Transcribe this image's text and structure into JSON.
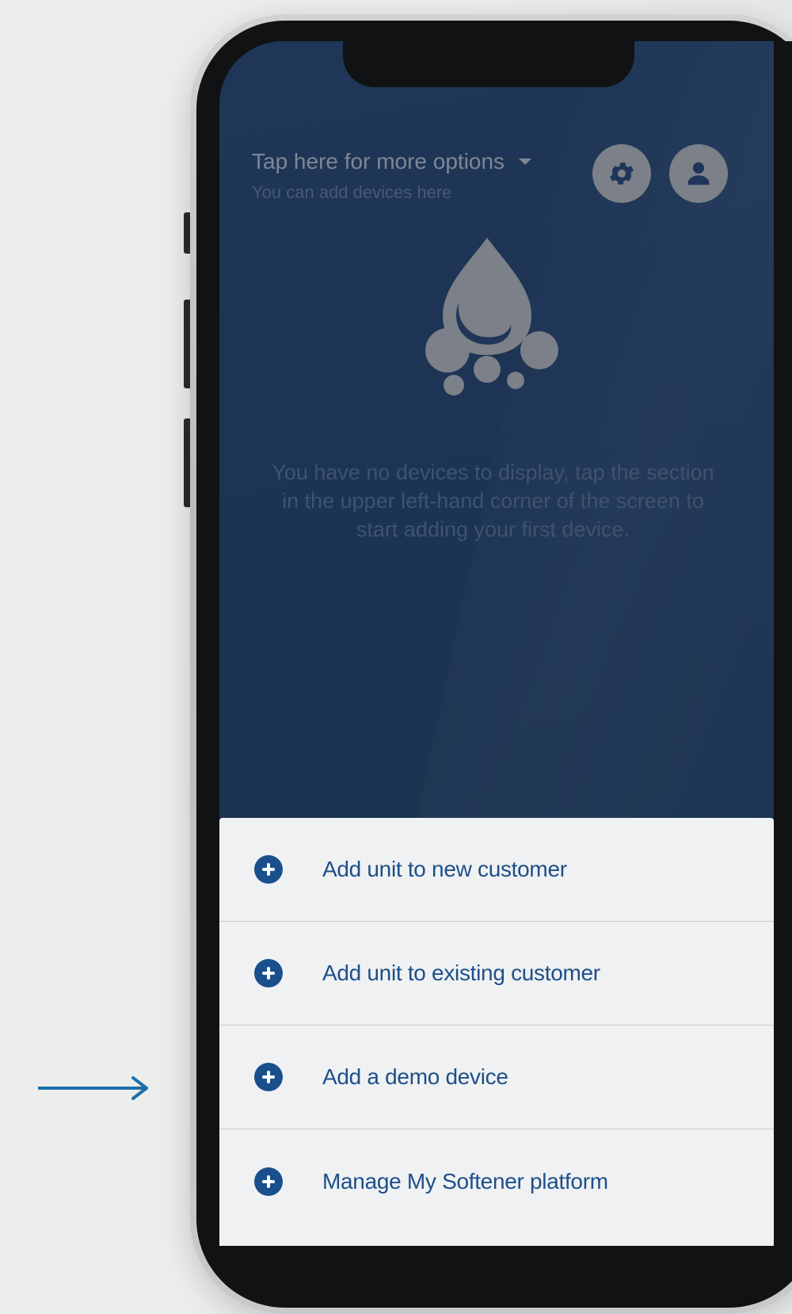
{
  "header": {
    "title": "Tap here for more options",
    "subtitle": "You can add devices here"
  },
  "icons": {
    "settings": "gear-icon",
    "profile": "user-icon",
    "empty_state": "water-drop-icon",
    "add": "plus-circle-icon",
    "pointer": "arrow-right-icon"
  },
  "empty_state": {
    "message": "You have no devices to display, tap the section in the upper left-hand corner of the screen to start adding your first device."
  },
  "menu": {
    "items": [
      {
        "label": "Add unit to new customer"
      },
      {
        "label": "Add unit to existing customer"
      },
      {
        "label": "Add a demo device"
      },
      {
        "label": "Manage My Softener platform"
      }
    ]
  },
  "colors": {
    "accent": "#1a4f8d",
    "pointer_arrow": "#1e6fa8",
    "screen_bg": "#1c3352"
  }
}
